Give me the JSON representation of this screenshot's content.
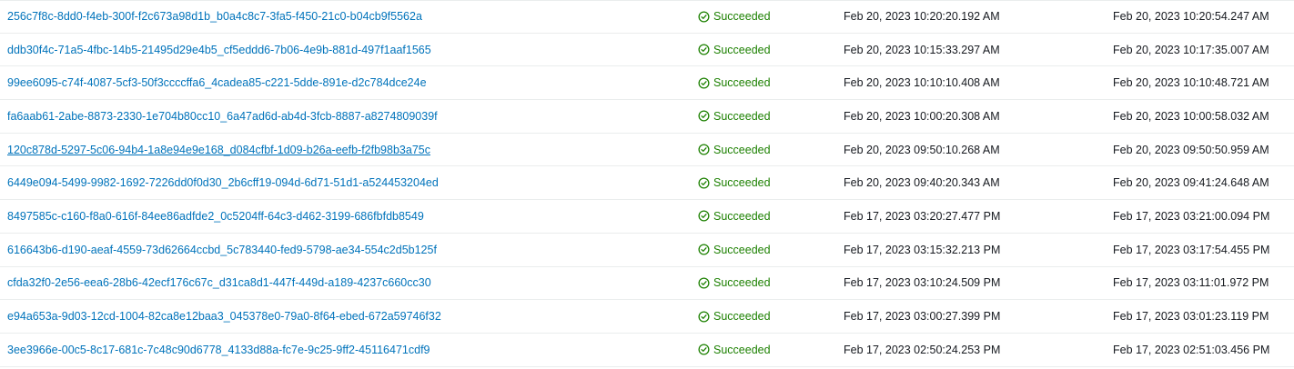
{
  "colors": {
    "link": "#0073bb",
    "success": "#1d8102",
    "divider": "#eaeded"
  },
  "executions": [
    {
      "name": "256c7f8c-8dd0-f4eb-300f-f2c673a98d1b_b0a4c8c7-3fa5-f450-21c0-b04cb9f5562a",
      "status": "Succeeded",
      "start": "Feb 20, 2023 10:20:20.192 AM",
      "end": "Feb 20, 2023 10:20:54.247 AM"
    },
    {
      "name": "ddb30f4c-71a5-4fbc-14b5-21495d29e4b5_cf5eddd6-7b06-4e9b-881d-497f1aaf1565",
      "status": "Succeeded",
      "start": "Feb 20, 2023 10:15:33.297 AM",
      "end": "Feb 20, 2023 10:17:35.007 AM"
    },
    {
      "name": "99ee6095-c74f-4087-5cf3-50f3ccccffa6_4cadea85-c221-5dde-891e-d2c784dce24e",
      "status": "Succeeded",
      "start": "Feb 20, 2023 10:10:10.408 AM",
      "end": "Feb 20, 2023 10:10:48.721 AM"
    },
    {
      "name": "fa6aab61-2abe-8873-2330-1e704b80cc10_6a47ad6d-ab4d-3fcb-8887-a8274809039f",
      "status": "Succeeded",
      "start": "Feb 20, 2023 10:00:20.308 AM",
      "end": "Feb 20, 2023 10:00:58.032 AM"
    },
    {
      "name": "120c878d-5297-5c06-94b4-1a8e94e9e168_d084cfbf-1d09-b26a-eefb-f2fb98b3a75c",
      "status": "Succeeded",
      "start": "Feb 20, 2023 09:50:10.268 AM",
      "end": "Feb 20, 2023 09:50:50.959 AM"
    },
    {
      "name": "6449e094-5499-9982-1692-7226dd0f0d30_2b6cff19-094d-6d71-51d1-a524453204ed",
      "status": "Succeeded",
      "start": "Feb 20, 2023 09:40:20.343 AM",
      "end": "Feb 20, 2023 09:41:24.648 AM"
    },
    {
      "name": "8497585c-c160-f8a0-616f-84ee86adfde2_0c5204ff-64c3-d462-3199-686fbfdb8549",
      "status": "Succeeded",
      "start": "Feb 17, 2023 03:20:27.477 PM",
      "end": "Feb 17, 2023 03:21:00.094 PM"
    },
    {
      "name": "616643b6-d190-aeaf-4559-73d62664ccbd_5c783440-fed9-5798-ae34-554c2d5b125f",
      "status": "Succeeded",
      "start": "Feb 17, 2023 03:15:32.213 PM",
      "end": "Feb 17, 2023 03:17:54.455 PM"
    },
    {
      "name": "cfda32f0-2e56-eea6-28b6-42ecf176c67c_d31ca8d1-447f-449d-a189-4237c660cc30",
      "status": "Succeeded",
      "start": "Feb 17, 2023 03:10:24.509 PM",
      "end": "Feb 17, 2023 03:11:01.972 PM"
    },
    {
      "name": "e94a653a-9d03-12cd-1004-82ca8e12baa3_045378e0-79a0-8f64-ebed-672a59746f32",
      "status": "Succeeded",
      "start": "Feb 17, 2023 03:00:27.399 PM",
      "end": "Feb 17, 2023 03:01:23.119 PM"
    },
    {
      "name": "3ee3966e-00c5-8c17-681c-7c48c90d6778_4133d88a-fc7e-9c25-9ff2-45116471cdf9",
      "status": "Succeeded",
      "start": "Feb 17, 2023 02:50:24.253 PM",
      "end": "Feb 17, 2023 02:51:03.456 PM"
    }
  ]
}
